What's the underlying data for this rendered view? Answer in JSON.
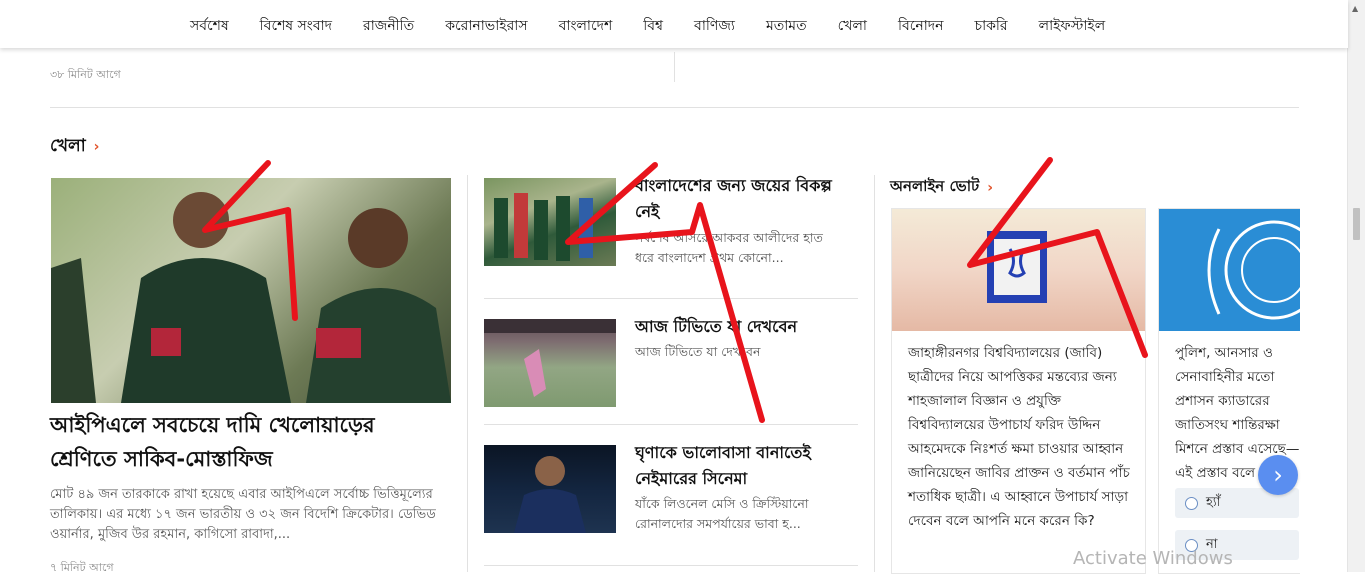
{
  "nav": {
    "items": [
      "সর্বশেষ",
      "বিশেষ সংবাদ",
      "রাজনীতি",
      "করোনাভাইরাস",
      "বাংলাদেশ",
      "বিশ্ব",
      "বাণিজ্য",
      "মতামত",
      "খেলা",
      "বিনোদন",
      "চাকরি",
      "লাইফস্টাইল"
    ]
  },
  "top_time": "৩৮ মিনিট আগে",
  "section": {
    "title": "খেলা",
    "chevron": "›"
  },
  "lead": {
    "headline": "আইপিএলে সবচেয়ে দামি খেলোয়াড়ের শ্রেণিতে সাকিব-মোস্তাফিজ",
    "summary": "মোট ৪৯ জন তারকাকে রাখা হয়েছে এবার আইপিএলে সর্বোচ্চ ভিত্তিমূল্যের তালিকায়। এর মধ্যে ১৭ জন ভারতীয় ও ৩২ জন বিদেশি ক্রিকেটার। ডেভিড ওয়ার্নার, মুজিব উর রহমান, কাগিসো রাবাদা,...",
    "time": "৭ মিনিট আগে"
  },
  "middle": [
    {
      "title": "বাংলাদেশের জন্য জয়ের বিকল্প নেই",
      "summary": "সর্বশেষ আসরে আকবর আলীদের হাত ধরে বাংলাদেশ প্রথম কোনো..."
    },
    {
      "title": "আজ টিভিতে যা দেখবেন",
      "summary": "আজ টিভিতে যা দেখবেন"
    },
    {
      "title": "ঘৃণাকে ভালোবাসা বানাতেই নেইমারের সিনেমা",
      "summary": "যাঁকে লিওনেল মেসি ও ক্রিস্টিয়ানো রোনালদোর সমপর্যায়ের ভাবা হ..."
    }
  ],
  "poll": {
    "label": "অনলাইন ভোট",
    "chevron": "›",
    "card1": "জাহাঙ্গীরনগর বিশ্ববিদ্যালয়ের (জাবি) ছাত্রীদের নিয়ে আপত্তিকর মন্তব্যের জন্য শাহজালাল বিজ্ঞান ও প্রযুক্তি বিশ্ববিদ্যালয়ের উপাচার্য ফরিদ উদ্দিন আহমেদকে নিঃশর্ত ক্ষমা চাওয়ার আহ্বান জানিয়েছেন জাবির প্রাক্তন ও বর্তমান পাঁচ শতাধিক ছাত্রী। এ আহ্বানে উপাচার্য সাড়া দেবেন বলে আপনি মনে করেন কি?",
    "card2": "পুলিশ, আনসার ও সেনাবাহিনীর মতো প্রশাসন ক্যাডারের জাতিসংঘ শান্তিরক্ষা মিশনে প্রস্তাব এসেছে—এই প্রস্তাব বলে আপনি মনে করেন",
    "options": [
      "হ্যাঁ",
      "না"
    ],
    "next_icon": "›"
  },
  "watermark": "Activate Windows",
  "annotation_color": "#e8141c"
}
